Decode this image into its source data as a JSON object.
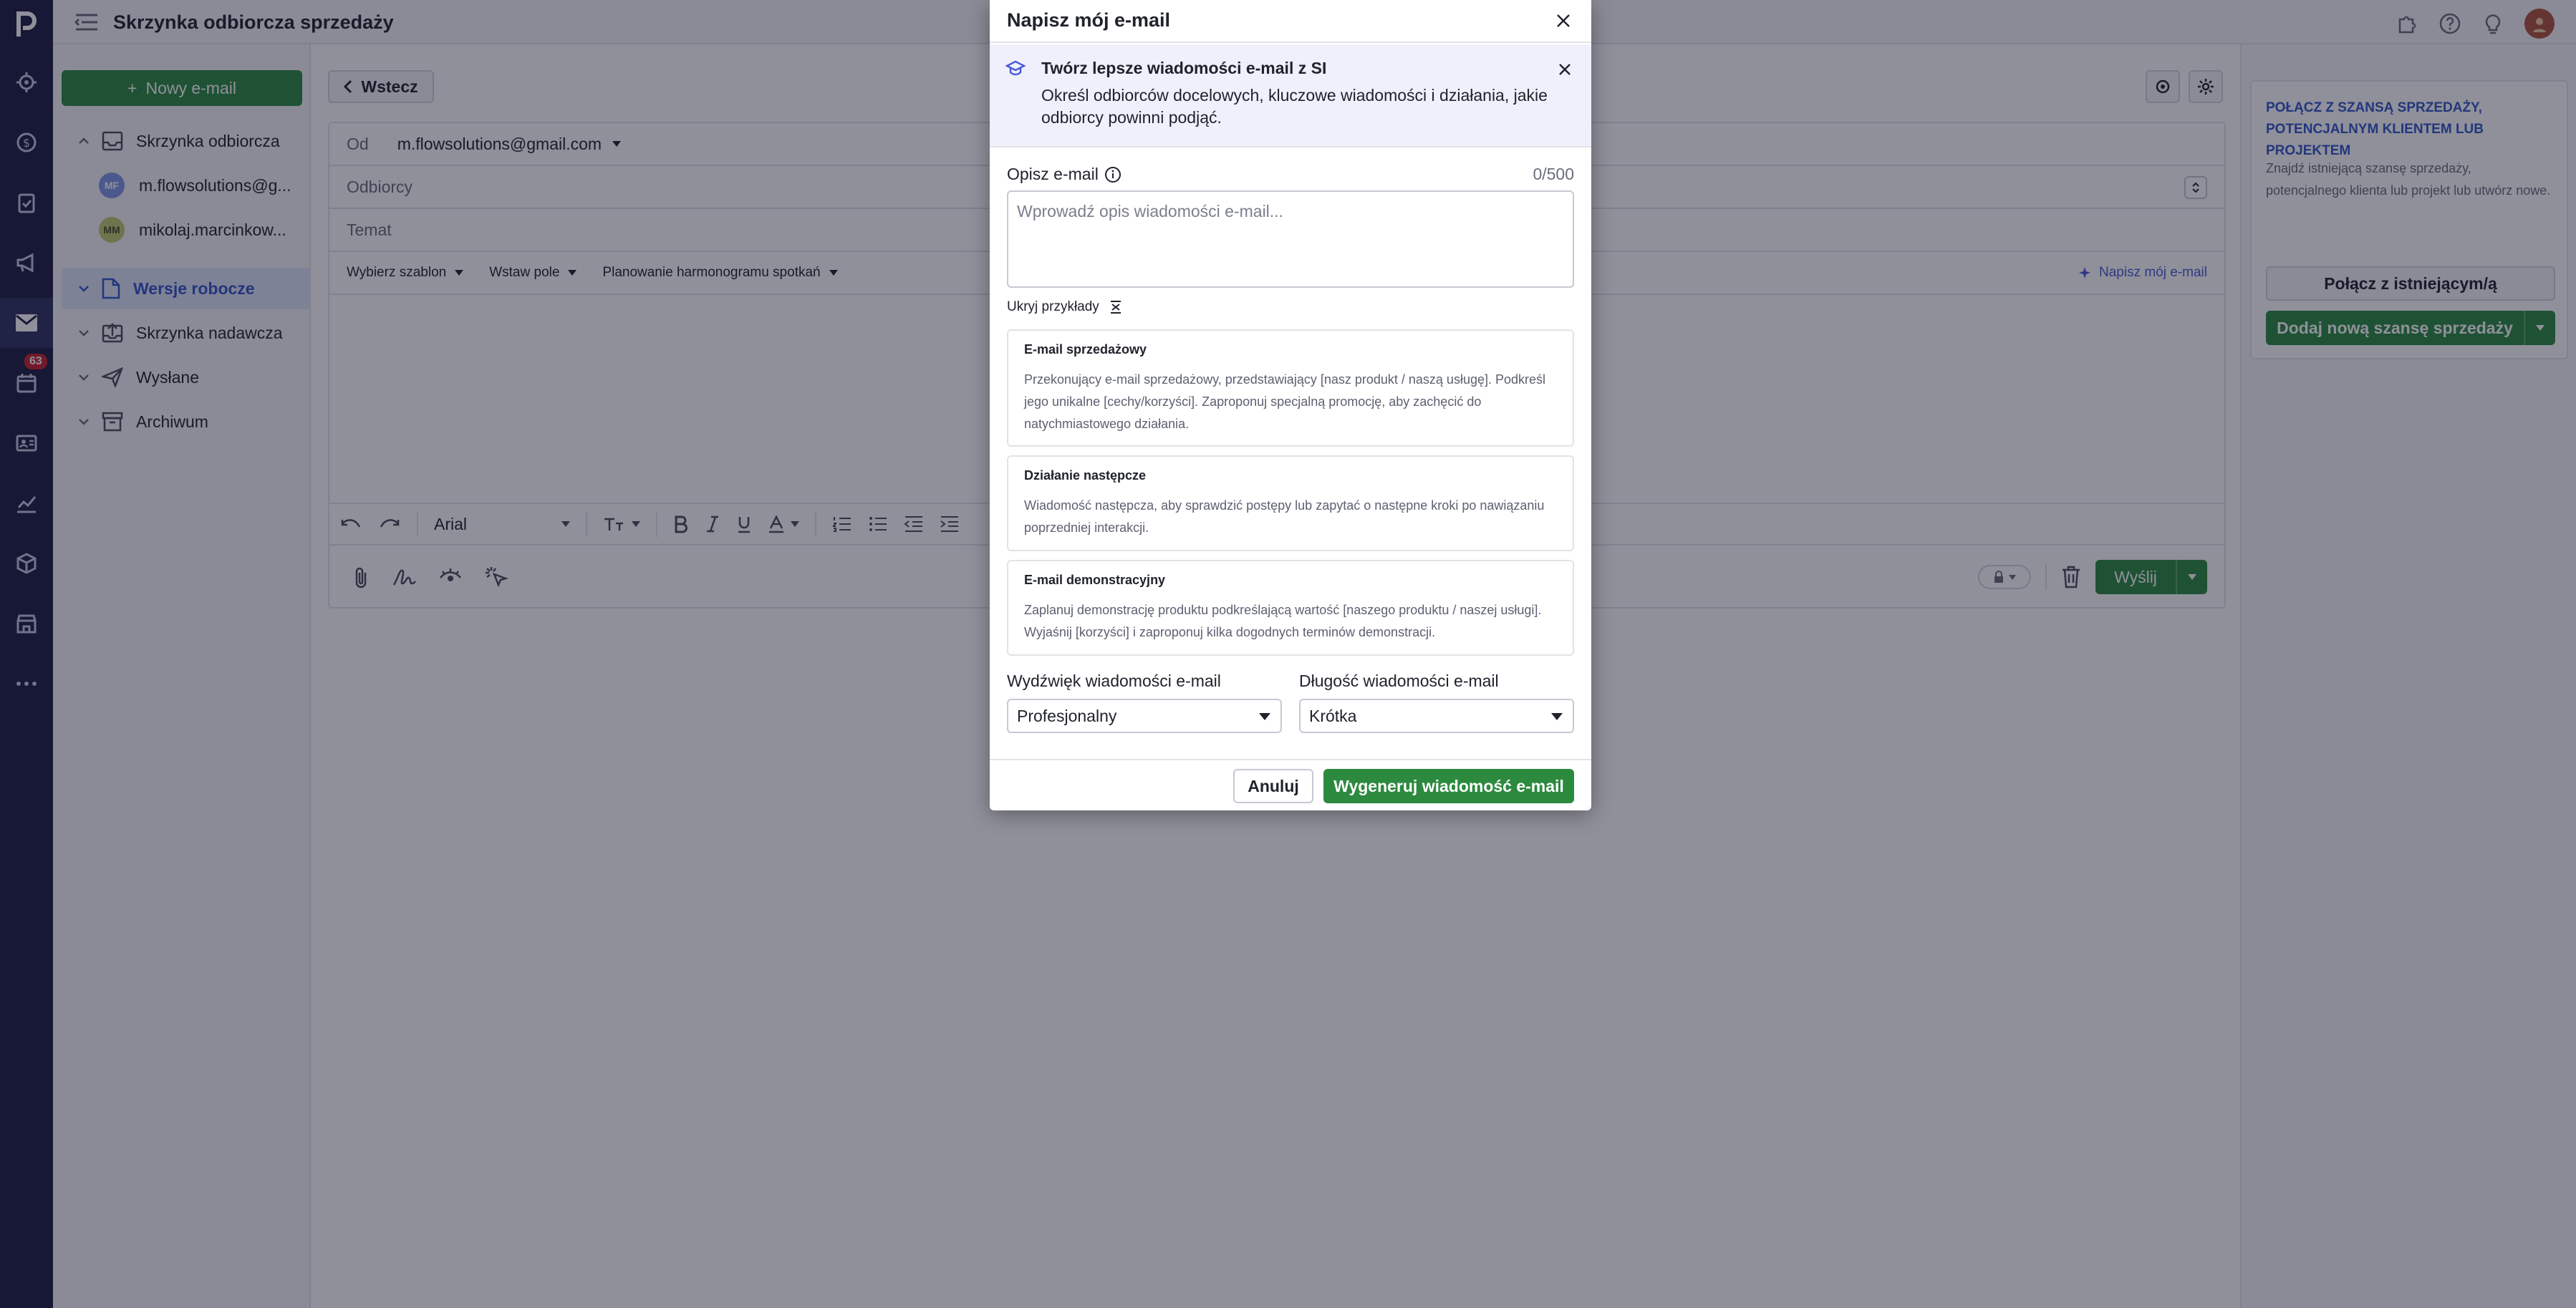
{
  "topbar": {
    "title": "Skrzynka odbiorcza sprzedaży"
  },
  "rail": {
    "badge_count": "63"
  },
  "folders": {
    "new_email_label": "Nowy e-mail",
    "inbox_label": "Skrzynka odbiorcza",
    "accounts": [
      {
        "initials": "MF",
        "name": "m.flowsolutions@g..."
      },
      {
        "initials": "MM",
        "name": "mikolaj.marcinkow..."
      }
    ],
    "items": [
      {
        "label": "Wersje robocze"
      },
      {
        "label": "Skrzynka nadawcza"
      },
      {
        "label": "Wysłane"
      },
      {
        "label": "Archiwum"
      }
    ]
  },
  "compose": {
    "back_label": "Wstecz",
    "from_label": "Od",
    "from_value": "m.flowsolutions@gmail.com",
    "to_placeholder": "Odbiorcy",
    "subject_placeholder": "Temat",
    "tools": {
      "template": "Wybierz szablon",
      "insert_field": "Wstaw pole",
      "scheduler": "Planowanie harmonogramu spotkań",
      "ai_write": "Napisz mój e-mail"
    },
    "font_name": "Arial",
    "send_label": "Wyślij"
  },
  "right_panel": {
    "heading": "POŁĄCZ Z SZANSĄ SPRZEDAŻY, POTENCJALNYM KLIENTEM LUB PROJEKTEM",
    "description": "Znajdź istniejącą szansę sprzedaży, potencjalnego klienta lub projekt lub utwórz nowe.",
    "link_existing": "Połącz z istniejącym/ą",
    "add_new": "Dodaj nową szansę sprzedaży"
  },
  "modal": {
    "title": "Napisz mój e-mail",
    "banner_title": "Twórz lepsze wiadomości e-mail z SI",
    "banner_text": "Określ odbiorców docelowych, kluczowe wiadomości i działania, jakie odbiorcy powinni podjąć.",
    "description_label": "Opisz e-mail",
    "char_count": "0/500",
    "description_placeholder": "Wprowadź opis wiadomości e-mail...",
    "hide_examples": "Ukryj przykłady",
    "examples": [
      {
        "title": "E-mail sprzedażowy",
        "text": "Przekonujący e-mail sprzedażowy, przedstawiający [nasz produkt / naszą usługę]. Podkreśl jego unikalne [cechy/korzyści]. Zaproponuj specjalną promocję, aby zachęcić do natychmiastowego działania."
      },
      {
        "title": "Działanie następcze",
        "text": "Wiadomość następcza, aby sprawdzić postępy lub zapytać o następne kroki po nawiązaniu poprzedniej interakcji."
      },
      {
        "title": "E-mail demonstracyjny",
        "text": "Zaplanuj demonstrację produktu podkreślającą wartość [naszego produktu / naszej usługi]. Wyjaśnij [korzyści] i zaproponuj kilka dogodnych terminów demonstracji."
      }
    ],
    "tone_label": "Wydźwięk wiadomości e-mail",
    "tone_value": "Profesjonalny",
    "length_label": "Długość wiadomości e-mail",
    "length_value": "Krótka",
    "cancel_label": "Anuluj",
    "generate_label": "Wygeneruj wiadomość e-mail"
  },
  "colors": {
    "brand_green": "#2c8a3f",
    "rail_bg": "#1c1d41",
    "accent_blue": "#3355c9",
    "ai_purple": "#4b5bd6",
    "badge_red": "#c8212c"
  }
}
